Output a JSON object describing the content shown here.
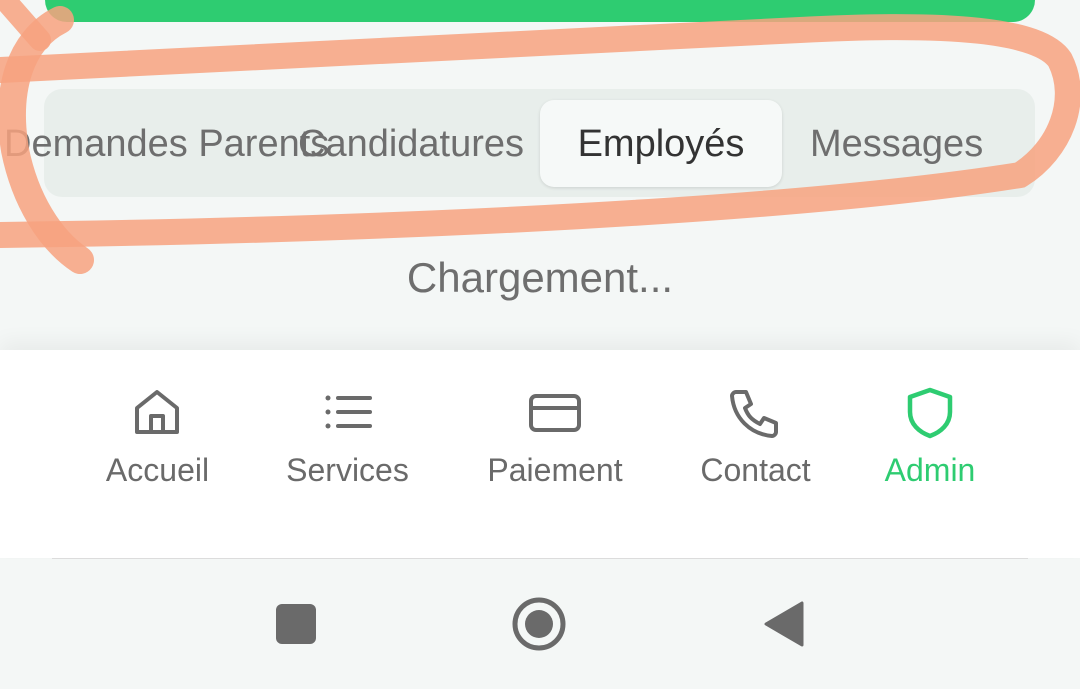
{
  "colors": {
    "accent": "#2ecc71",
    "annotation": "#f7a27f",
    "inactive": "#6a6a6a"
  },
  "tabs": {
    "items": [
      {
        "label": "Demandes Parents",
        "active": false
      },
      {
        "label": "Candidatures",
        "active": false
      },
      {
        "label": "Employés",
        "active": true
      },
      {
        "label": "Messages",
        "active": false
      }
    ]
  },
  "status": {
    "loading_text": "Chargement..."
  },
  "bottom_nav": {
    "items": [
      {
        "label": "Accueil",
        "icon": "home-icon",
        "active": false
      },
      {
        "label": "Services",
        "icon": "list-icon",
        "active": false
      },
      {
        "label": "Paiement",
        "icon": "credit-card-icon",
        "active": false
      },
      {
        "label": "Contact",
        "icon": "phone-icon",
        "active": false
      },
      {
        "label": "Admin",
        "icon": "shield-icon",
        "active": true
      }
    ]
  },
  "system_nav": {
    "buttons": [
      "recents-icon",
      "home-button-icon",
      "back-icon"
    ]
  }
}
